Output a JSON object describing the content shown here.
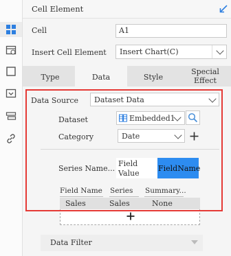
{
  "sidebar": {
    "icons": [
      "grid-icon",
      "cell-attribute-icon",
      "border-icon",
      "widget-icon",
      "stack-icon",
      "link-icon"
    ],
    "active": "grid-icon"
  },
  "header": {
    "title": "Cell Element",
    "collapse_icon": "arrow-collapse-icon"
  },
  "cell": {
    "label": "Cell",
    "value": "A1"
  },
  "insert_cell_element": {
    "label": "Insert Cell Element",
    "value": "Insert Chart(C)"
  },
  "tabs": [
    {
      "label": "Type",
      "active": false
    },
    {
      "label": "Data",
      "active": true
    },
    {
      "label": "Style",
      "active": false
    },
    {
      "label_line1": "Special",
      "label_line2": "Effect",
      "active": false
    }
  ],
  "data_source": {
    "label": "Data Source",
    "value": "Dataset Data"
  },
  "dataset": {
    "label": "Dataset",
    "value": "Embedded1",
    "search_icon": "search-icon",
    "db_icon": "database-icon"
  },
  "category": {
    "label": "Category",
    "value": "Date"
  },
  "series_name": {
    "label": "Series Name...",
    "option1_line1": "Field",
    "option1_line2": "Value",
    "option2": "FieldName",
    "selected": "FieldName"
  },
  "series_table": {
    "headers": [
      "Field Name",
      "Series",
      "Summary..."
    ],
    "row": [
      "Sales",
      "Sales",
      "None"
    ]
  },
  "add_symbol": "+",
  "data_filter": {
    "label": "Data Filter"
  },
  "colors": {
    "accent": "#3d8ee8",
    "selected": "#2d8cf0",
    "highlight": "#e53935"
  }
}
